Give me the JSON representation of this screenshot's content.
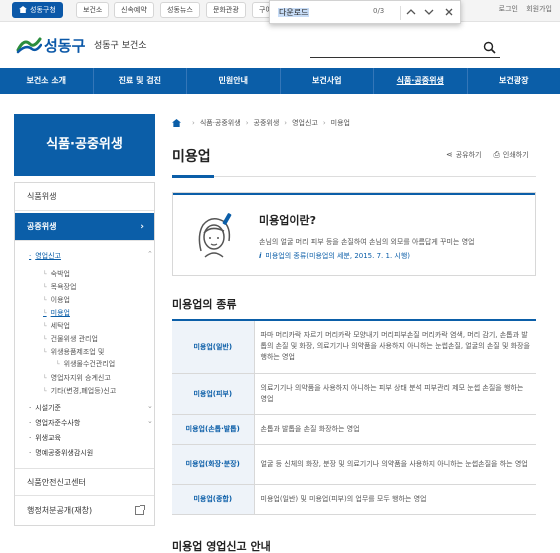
{
  "top_tabs": [
    {
      "label": "성동구청",
      "active": true
    },
    {
      "label": "보건소"
    },
    {
      "label": "신속예약"
    },
    {
      "label": "성동뉴스"
    },
    {
      "label": "문화관광"
    },
    {
      "label": "구여"
    }
  ],
  "top_links": {
    "login": "로그인",
    "join": "회원가입"
  },
  "findbar": {
    "query": "다운로드",
    "count": "0/3"
  },
  "header": {
    "logo_text": "성동구",
    "site_name": "성동구 보건소"
  },
  "gnb": [
    "보건소 소개",
    "진료 및 검진",
    "민원안내",
    "보건사업",
    "식품·공중위생",
    "보건광장"
  ],
  "sidebar": {
    "title": "식품·공중위생",
    "l1_food": "식품위생",
    "l1_public": "공중위생",
    "l2_business": "영업신고",
    "l3_items": [
      "숙박업",
      "목욕장업",
      "이용업",
      "미용업",
      "세탁업",
      "건물위생 관리업",
      "위생용품제조업 및",
      "위생물수건관리업",
      "영업자지위 승계신고",
      "기타(변경,폐업등)신고"
    ],
    "l2_rest": [
      "시설기준",
      "영업자준수사항",
      "위생교육",
      "명예공중위생감시원"
    ],
    "l1_report": "식품안전신고센터",
    "l1_disclosure": "행정처분공개(재창)"
  },
  "breadcrumb": [
    "식품·공중위생",
    "공중위생",
    "영업신고",
    "미용업"
  ],
  "page": {
    "title": "미용업",
    "share": "공유하기",
    "print": "인쇄하기"
  },
  "info": {
    "title": "미용업이란?",
    "desc": "손님의 얼굴 머리 피부 등을 손질하여 손님의 외모를 아름답게 꾸미는 영업",
    "law": "미용업의 종류(미용업의 세분, 2015. 7. 1. 시행)"
  },
  "types_section": {
    "title": "미용업의 종류",
    "rows": [
      {
        "name": "미용업(일반)",
        "desc": "파마 머리카락 자르기 머리카락 모양내기 머리피부손질 머리카락 염색, 머리 감기, 손톱과 발톱의 손질 및 화장, 의료기기나 의약품을 사용하지 아니하는 눈썹손질, 얼굴의 손질 및 화장을 행하는 영업"
      },
      {
        "name": "미용업(피부)",
        "desc": "의료기기나 의약품을 사용하지 아니하는 피부 상태 분석 피부관리 제모 눈썹 손질을 행하는 영업"
      },
      {
        "name": "미용업(손톱·발톱)",
        "desc": "손톱과 발톱을 손질 화장하는 영업"
      },
      {
        "name": "미용업(화장·분장)",
        "desc": "얼굴 등 신체의 화장, 분장 및 의료기기나 의약품을 사용하지 아니하는 눈썹손질을 하는 영업"
      },
      {
        "name": "미용업(종합)",
        "desc": "미용업(일반) 및 미용업(피부)의 업무를 모두 행하는 영업"
      }
    ]
  },
  "next_section_title": "미용업 영업신고 안내"
}
